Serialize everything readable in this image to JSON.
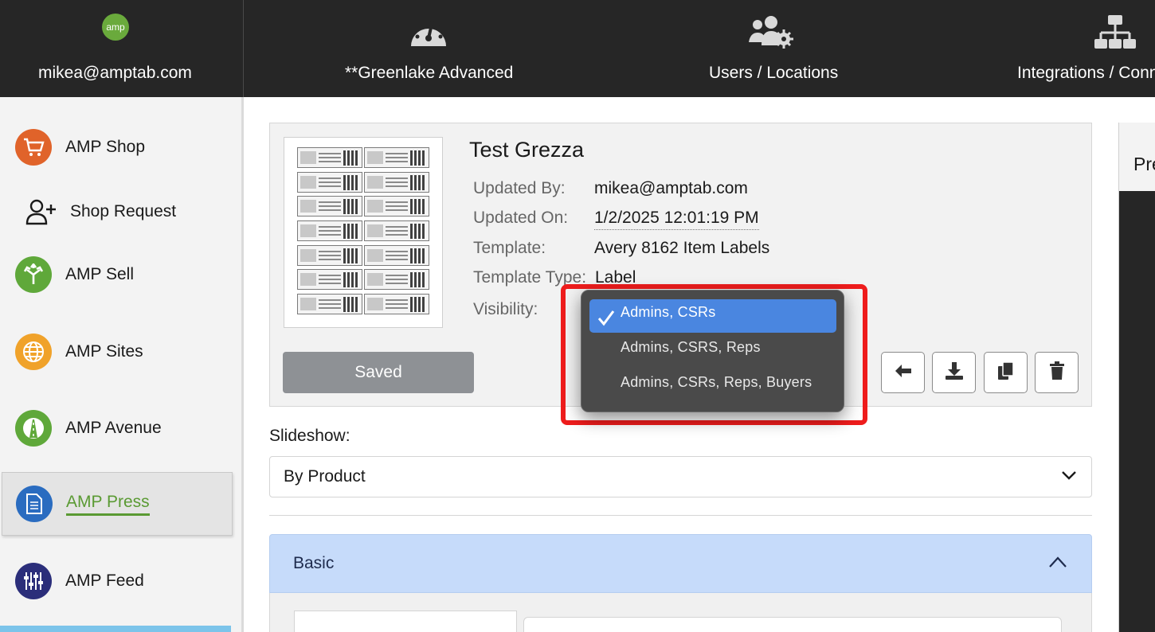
{
  "topnav": {
    "account_logo": "amp",
    "account_email": "mikea@amptab.com",
    "items": [
      {
        "label": "**Greenlake Advanced",
        "icon": "gauge-icon"
      },
      {
        "label": "Users / Locations",
        "icon": "users-gear-icon"
      },
      {
        "label": "Integrations / Conn",
        "icon": "network-icon"
      }
    ]
  },
  "sidebar": {
    "items": [
      {
        "label": "AMP Shop",
        "icon": "cart-icon",
        "color": "#e0632a"
      },
      {
        "label": "Shop Request",
        "icon": "user-plus-icon"
      },
      {
        "label": "AMP Sell",
        "icon": "arrows-split-icon",
        "color": "#5fa83a"
      },
      {
        "label": "AMP Sites",
        "icon": "globe-icon",
        "color": "#f0a22a"
      },
      {
        "label": "AMP Avenue",
        "icon": "road-icon",
        "color": "#5fa83a"
      },
      {
        "label": "AMP Press",
        "icon": "document-icon",
        "color": "#2a6cc0",
        "active": true
      },
      {
        "label": "AMP Feed",
        "icon": "sliders-icon",
        "color": "#2b2e7a"
      }
    ]
  },
  "record": {
    "title": "Test Grezza",
    "fields": [
      {
        "key": "Updated By:",
        "value": "mikea@amptab.com"
      },
      {
        "key": "Updated On:",
        "value": "1/2/2025 12:01:19 PM"
      },
      {
        "key": "Template:",
        "value": "Avery 8162 Item Labels"
      },
      {
        "key": "Template Type:",
        "value": "Label"
      },
      {
        "key": "Visibility:",
        "value": ""
      }
    ],
    "saved_label": "Saved",
    "actions": [
      "back-arrow-icon",
      "download-icon",
      "copy-icon",
      "trash-icon"
    ]
  },
  "visibility_menu": {
    "options": [
      "Admins, CSRs",
      "Admins, CSRS, Reps",
      "Admins, CSRs, Reps, Buyers"
    ],
    "selected": "Admins, CSRs",
    "highlight_color": "#ee1c1c"
  },
  "slideshow": {
    "label": "Slideshow:",
    "value": "By Product"
  },
  "accordion": {
    "title": "Basic"
  },
  "right_panel": {
    "title": "Pre"
  },
  "colors": {
    "nav_bg": "#262626",
    "accent_green": "#5a9a33",
    "accordion_bg": "#c6dbfa",
    "menu_selected": "#4a86e0"
  }
}
